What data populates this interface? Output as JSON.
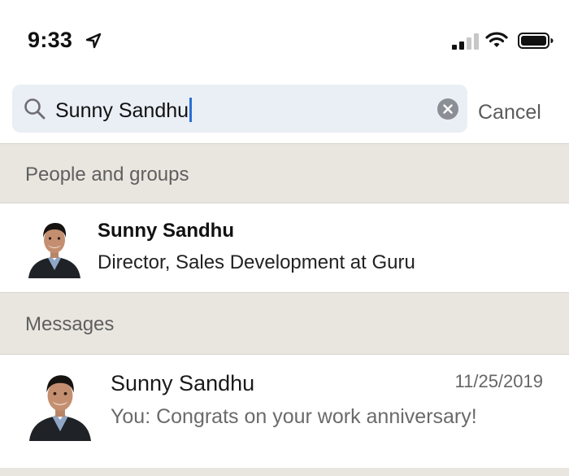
{
  "status_bar": {
    "time": "9:33",
    "icons": [
      "location-arrow-icon",
      "cellular-signal-icon",
      "wifi-icon",
      "battery-icon"
    ]
  },
  "search": {
    "value": "Sunny Sandhu",
    "placeholder": "Search",
    "cancel_label": "Cancel"
  },
  "sections": {
    "people": {
      "header": "People and groups",
      "items": [
        {
          "name": "Sunny Sandhu",
          "title": "Director, Sales Development at Guru"
        }
      ]
    },
    "messages": {
      "header": "Messages",
      "items": [
        {
          "name": "Sunny Sandhu",
          "date": "11/25/2019",
          "preview": "You: Congrats on your work anniversary!"
        }
      ]
    }
  },
  "colors": {
    "accent_caret": "#2a6fd6",
    "search_field_bg": "#eaeef5",
    "section_header_bg": "#e9e6e0"
  }
}
